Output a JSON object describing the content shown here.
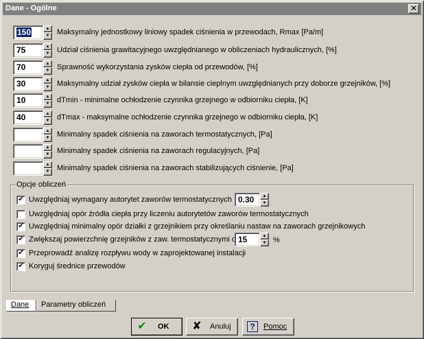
{
  "window": {
    "title": "Dane - Ogólne",
    "close_glyph": "✕"
  },
  "fields": [
    {
      "value": "150",
      "selected": true,
      "label": "Maksymalny jednostkowy liniowy spadek ciśnienia w przewodach, Rmax [Pa/m]"
    },
    {
      "value": "75",
      "label": "Udział ciśnienia grawitacyjnego uwzględnianego w obliczeniach hydraulicznych, [%]"
    },
    {
      "value": "70",
      "label": "Sprawność wykorzystania  zysków ciepła od przewodów, [%]"
    },
    {
      "value": "30",
      "label": "Maksymalny udział zysków ciepła w bilansie cieplnym uwzględnianych przy doborze grzejników, [%]"
    },
    {
      "value": "10",
      "label": "dTmin - minimalne ochłodzenie czynnika grzejnego w odbiorniku ciepła, [K]"
    },
    {
      "value": "40",
      "label": "dTmax - maksymalne ochłodzenie czynnika grzejnego w odbiorniku ciepła, [K]"
    },
    {
      "value": "",
      "label": "Minimalny spadek ciśnienia na zaworach termostatycznych, [Pa]"
    },
    {
      "value": "",
      "label": "Minimalny spadek ciśnienia na zaworach regulacyjnych, [Pa]"
    },
    {
      "value": "",
      "label": "Minimalny spadek ciśnienia na zaworach stabilizujących ciśnienie, [Pa]"
    }
  ],
  "options": {
    "title": "Opcje obliczeń",
    "items": [
      {
        "checked": true,
        "label": "Uwzględniaj wymagany autorytet zaworów termostatycznych",
        "spin_value": "0.30"
      },
      {
        "checked": false,
        "label": "Uwzględniaj opór źródła ciepła przy liczeniu autorytetów zaworów termostatycznych"
      },
      {
        "checked": true,
        "label": "Uwzględniaj minimalny opór działki z grzejnikiem  przy określaniu nastaw na zaworach grzejnikowych"
      },
      {
        "checked": true,
        "label": "Zwiększaj powierzchnię grzejników z zaw. termostatycznymi o",
        "spin_value": "15",
        "unit": "%"
      },
      {
        "checked": true,
        "label": "Przeprowadź analizę rozpływu wody w zaprojektowanej instalacji"
      },
      {
        "checked": true,
        "label": "Koryguj średnice przewodów"
      }
    ]
  },
  "tabs": [
    {
      "label": "Dane",
      "active": true
    },
    {
      "label": "Parametry obliczeń",
      "active": false
    }
  ],
  "buttons": {
    "ok": {
      "label": "OK",
      "icon": "✔"
    },
    "cancel": {
      "label": "Anuluj",
      "icon": "✘"
    },
    "help": {
      "label": "Pomoc",
      "icon": "?"
    }
  },
  "glyphs": {
    "check": "✔",
    "up": "▲",
    "down": "▼"
  }
}
